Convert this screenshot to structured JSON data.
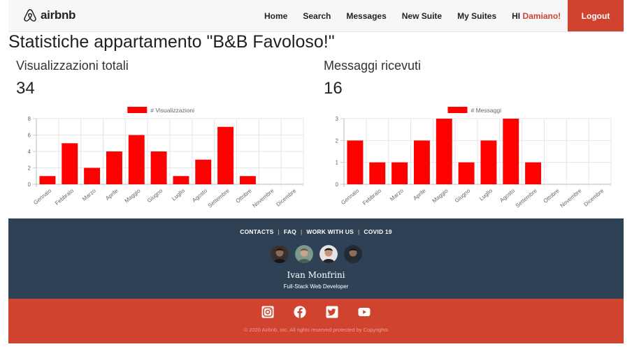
{
  "navbar": {
    "brand": "airbnb",
    "links": [
      "Home",
      "Search",
      "Messages",
      "New Suite",
      "My Suites"
    ],
    "greeting": "Hi",
    "username": "Damiano!",
    "logout": "Logout"
  },
  "page_title": "Statistiche appartamento \"B&B Favoloso!\"",
  "stats": {
    "views_label": "Visualizzazioni totali",
    "views_value": "34",
    "messages_label": "Messaggi ricevuti",
    "messages_value": "16"
  },
  "chart_data": [
    {
      "type": "bar",
      "categories": [
        "Gennaio",
        "Febbraio",
        "Marzo",
        "Aprile",
        "Maggio",
        "Giugno",
        "Luglio",
        "Agosto",
        "Settembre",
        "Ottobre",
        "Novembre",
        "Dicembre"
      ],
      "series": [
        {
          "name": "# Visualizzazioni",
          "values": [
            1,
            5,
            2,
            4,
            6,
            4,
            1,
            3,
            7,
            1,
            0,
            0
          ],
          "color": "#ff0000"
        }
      ],
      "ylim": [
        0,
        8
      ],
      "yticks": [
        0,
        2,
        4,
        6,
        8
      ],
      "grid": true,
      "legend": "top-center"
    },
    {
      "type": "bar",
      "categories": [
        "Gennaio",
        "Febbraio",
        "Marzo",
        "Aprile",
        "Maggio",
        "Giugno",
        "Luglio",
        "Agosto",
        "Settembre",
        "Ottobre",
        "Novembre",
        "Dicembre"
      ],
      "series": [
        {
          "name": "# Messaggi",
          "values": [
            2,
            1,
            1,
            2,
            3,
            1,
            2,
            3,
            1,
            0,
            0,
            0
          ],
          "color": "#ff0000"
        }
      ],
      "ylim": [
        0,
        3
      ],
      "yticks": [
        0,
        1,
        2,
        3
      ],
      "grid": true,
      "legend": "top-center"
    }
  ],
  "footer": {
    "links": [
      "CONTACTS",
      "FAQ",
      "WORK WITH US",
      "COVID 19"
    ],
    "team_avatars": [
      "avatar-1",
      "avatar-2",
      "avatar-3",
      "avatar-4"
    ],
    "developer_name": "Ivan Monfrini",
    "developer_role": "Full-Stack Web Developer",
    "socials": [
      "instagram-icon",
      "facebook-icon",
      "twitter-icon",
      "youtube-icon"
    ],
    "copyright": "© 2020 Airbnb, Inc. All rights reserved protected by Copyrights"
  },
  "colors": {
    "accent": "#d0432f",
    "footer_dark": "#2f4154",
    "bar": "#ff0000",
    "navbar_bg": "#f7f7f7"
  }
}
